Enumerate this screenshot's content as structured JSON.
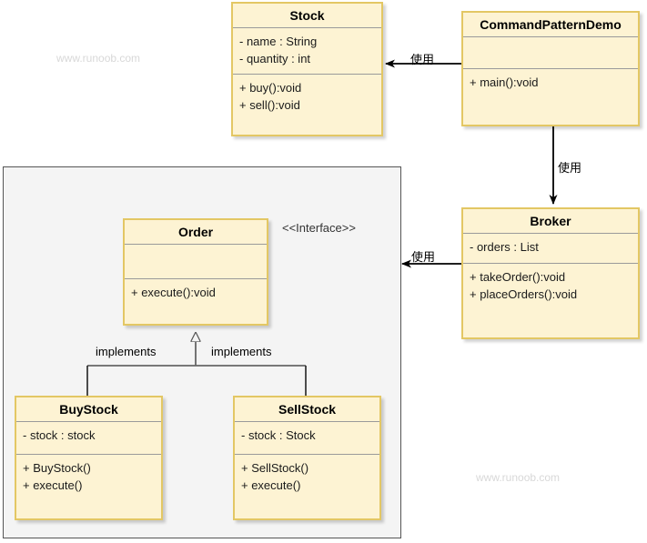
{
  "diagram": {
    "title": "Command Pattern UML Class Diagram",
    "colors": {
      "class_fill": "#fdf3d3",
      "class_border": "#e3c764",
      "package_fill": "#f4f4f4",
      "package_border": "#555555",
      "edge": "#000000",
      "inherit_edge": "#666666",
      "watermark": "#d8d8d8"
    }
  },
  "classes": {
    "stock": {
      "name": "Stock",
      "attributes": [
        "- name : String",
        "- quantity : int"
      ],
      "methods": [
        "+ buy():void",
        "+ sell():void"
      ]
    },
    "command_pattern_demo": {
      "name": "CommandPatternDemo",
      "attributes": [],
      "methods": [
        "+ main():void"
      ]
    },
    "broker": {
      "name": "Broker",
      "attributes": [
        "- orders : List"
      ],
      "methods": [
        "+ takeOrder():void",
        "+ placeOrders():void"
      ]
    },
    "order": {
      "name": "Order",
      "stereotype": "<<Interface>>",
      "attributes": [],
      "methods": [
        "+ execute():void"
      ]
    },
    "buy_stock": {
      "name": "BuyStock",
      "attributes": [
        "- stock : stock"
      ],
      "methods": [
        "+ BuyStock()",
        "+ execute()"
      ]
    },
    "sell_stock": {
      "name": "SellStock",
      "attributes": [
        "- stock : Stock"
      ],
      "methods": [
        "+ SellStock()",
        "+ execute()"
      ]
    }
  },
  "edges": {
    "demo_uses_stock": "使用",
    "demo_uses_broker": "使用",
    "broker_uses_order": "使用",
    "buystock_implements": "implements",
    "sellstock_implements": "implements"
  },
  "watermarks": {
    "top_left": "www.runoob.com",
    "bottom_right": "www.runoob.com"
  }
}
